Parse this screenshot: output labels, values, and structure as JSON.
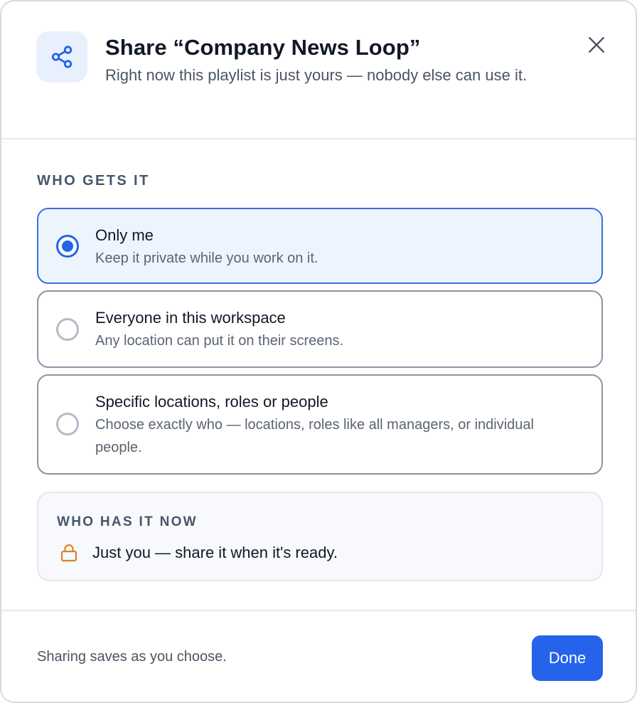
{
  "dialog": {
    "icon": "share-icon",
    "title": "Share “Company News Loop”",
    "subtitle": "Right now this playlist is just yours — nobody else can use it.",
    "close_icon": "close-icon"
  },
  "audience": {
    "section_label": "WHO GETS IT",
    "options": [
      {
        "title": "Only me",
        "description": "Keep it private while you work on it.",
        "selected": true
      },
      {
        "title": "Everyone in this workspace",
        "description": "Any location can put it on their screens.",
        "selected": false
      },
      {
        "title": "Specific locations, roles or people",
        "description": "Choose exactly who — locations, roles like all managers, or individual people.",
        "selected": false
      }
    ]
  },
  "status": {
    "label": "WHO HAS IT NOW",
    "icon": "lock-icon",
    "text": "Just you — share it when it's ready."
  },
  "footer": {
    "note": "Sharing saves as you choose.",
    "done_label": "Done"
  },
  "colors": {
    "accent": "#2563eb",
    "selected_bg": "#eef4fe",
    "lock": "#e0821e"
  }
}
